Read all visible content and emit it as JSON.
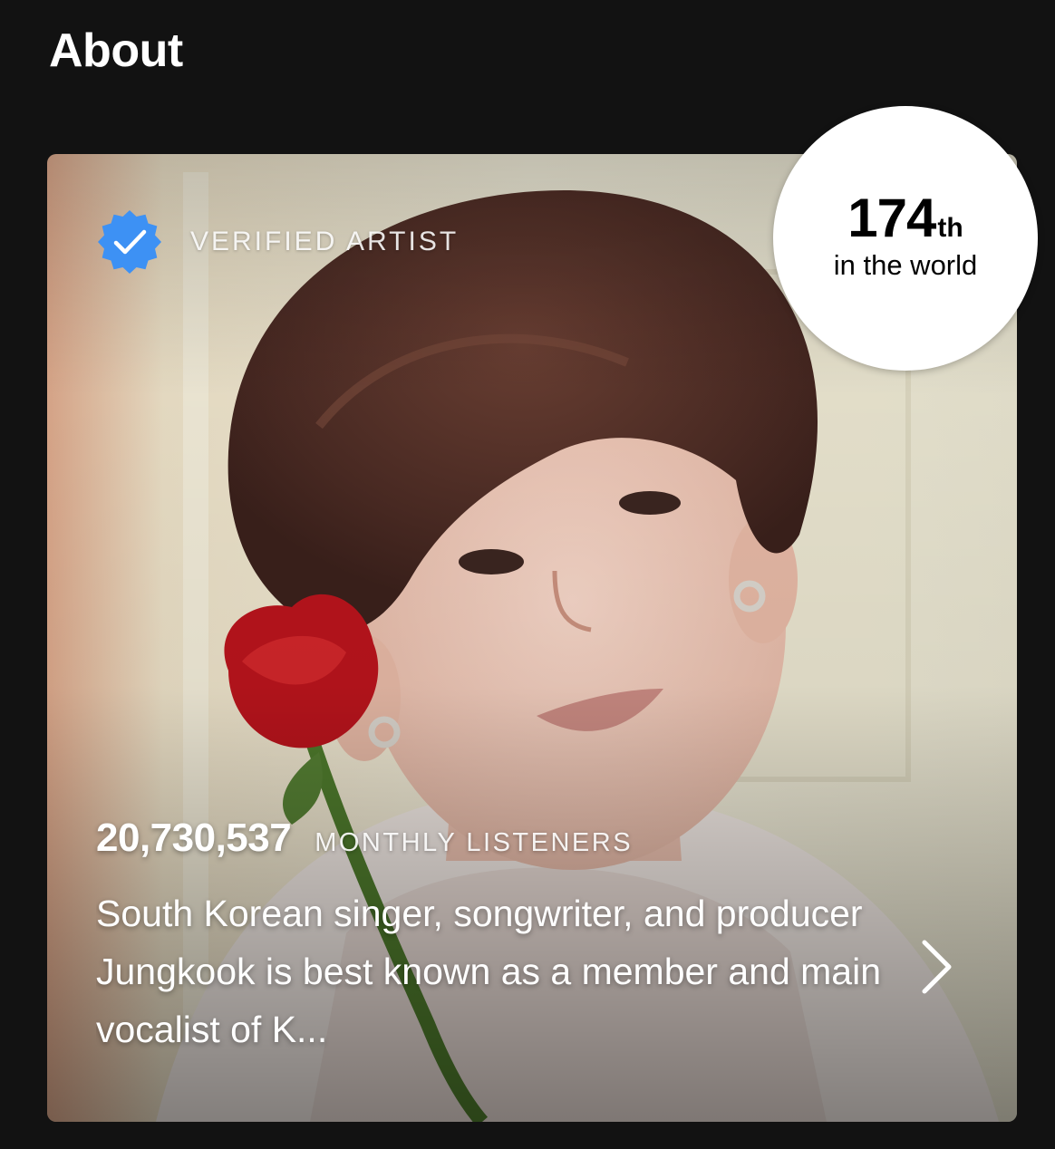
{
  "section": {
    "title": "About"
  },
  "card": {
    "photo": "artist-photo-with-red-rose",
    "verified": {
      "icon": "verified-badge-icon",
      "label": "VERIFIED ARTIST",
      "color": "#3d91f4"
    },
    "monthly_listeners": {
      "count": "20,730,537",
      "label": "MONTHLY LISTENERS"
    },
    "bio": "South Korean singer, songwriter, and producer Jungkook is best known as a member and main vocalist of K...",
    "more_icon": "chevron-right-icon"
  },
  "rank": {
    "number": "174",
    "suffix": "th",
    "caption": "in the world"
  }
}
